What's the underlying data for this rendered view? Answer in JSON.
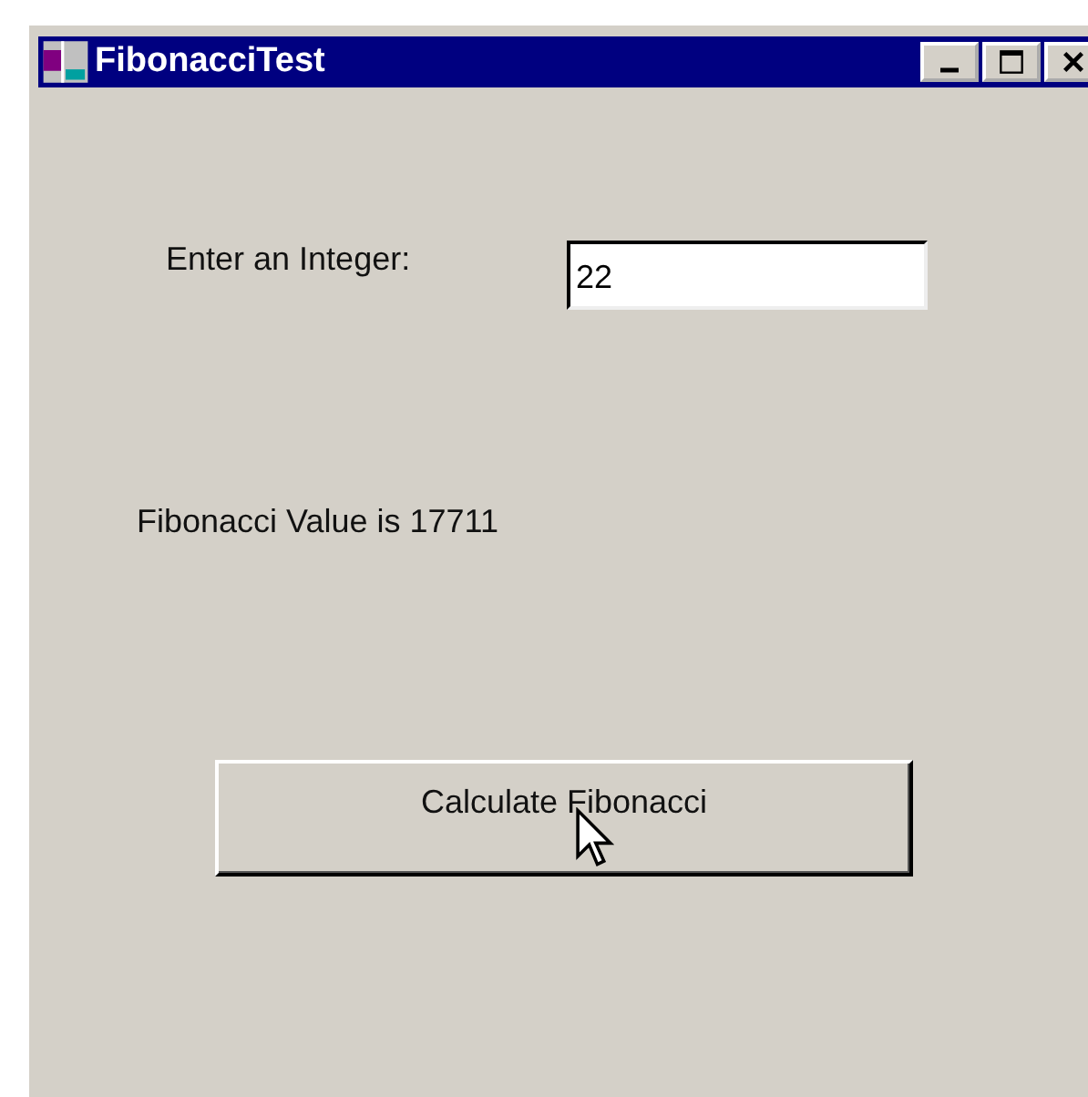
{
  "window": {
    "title": "FibonacciTest"
  },
  "input": {
    "label": "Enter an Integer:",
    "value": "22"
  },
  "result": {
    "text": "Fibonacci Value is 17711"
  },
  "buttons": [
    {
      "label": "Calculate Fibonacci"
    }
  ]
}
